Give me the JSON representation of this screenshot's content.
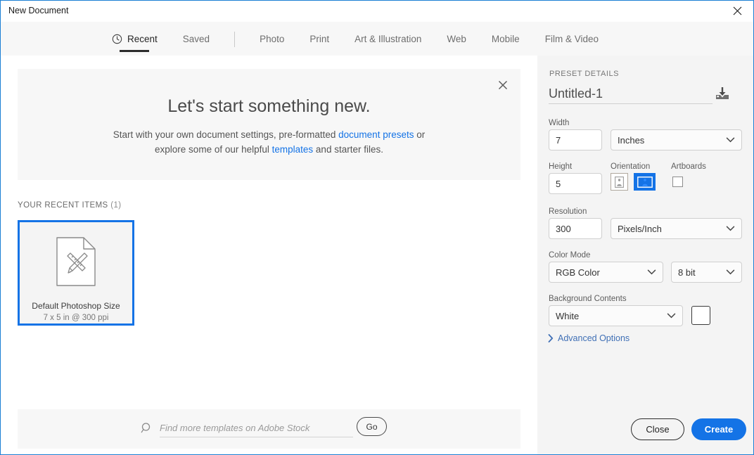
{
  "window": {
    "title": "New Document",
    "close_icon": "close-icon"
  },
  "tabs": [
    {
      "label": "Recent",
      "icon": "clock-icon",
      "active": true
    },
    {
      "label": "Saved",
      "active": false
    },
    {
      "label": "Photo",
      "active": false
    },
    {
      "label": "Print",
      "active": false
    },
    {
      "label": "Art & Illustration",
      "active": false
    },
    {
      "label": "Web",
      "active": false
    },
    {
      "label": "Mobile",
      "active": false
    },
    {
      "label": "Film & Video",
      "active": false
    }
  ],
  "banner": {
    "title": "Let's start something new.",
    "line1_before": "Start with your own document settings, pre-formatted ",
    "line1_link": "document presets",
    "line1_after": " or",
    "line2_before": "explore some of our helpful ",
    "line2_link": "templates",
    "line2_after": " and starter files.",
    "close_icon": "close-icon"
  },
  "recent": {
    "heading": "YOUR RECENT ITEMS",
    "count": "(1)",
    "items": [
      {
        "name": "Default Photoshop Size",
        "meta": "7 x 5 in @ 300 ppi",
        "icon": "document-pencil-ruler-icon",
        "selected": true
      }
    ]
  },
  "stock": {
    "search_icon": "search-icon",
    "placeholder": "Find more templates on Adobe Stock",
    "value": "",
    "go_label": "Go"
  },
  "preset": {
    "heading": "PRESET DETAILS",
    "doc_name": "Untitled-1",
    "doc_name_placeholder": "Untitled-1",
    "save_icon": "save-preset-icon",
    "width": {
      "label": "Width",
      "value": "7",
      "unit": "Inches"
    },
    "height": {
      "label": "Height",
      "value": "5"
    },
    "orientation": {
      "label": "Orientation",
      "portrait_icon": "portrait-orientation-icon",
      "landscape_icon": "landscape-orientation-icon",
      "selected": "landscape"
    },
    "artboards": {
      "label": "Artboards",
      "checked": false
    },
    "resolution": {
      "label": "Resolution",
      "value": "300",
      "unit": "Pixels/Inch"
    },
    "color_mode": {
      "label": "Color Mode",
      "value": "RGB Color",
      "depth": "8 bit"
    },
    "background": {
      "label": "Background Contents",
      "value": "White",
      "swatch_color": "#ffffff"
    },
    "advanced_label": "Advanced Options",
    "advanced_icon": "chevron-right-icon"
  },
  "footer": {
    "close_label": "Close",
    "create_label": "Create"
  },
  "colors": {
    "accent": "#1473e6",
    "link": "#1473e6",
    "window_border": "#1b7fd4"
  }
}
